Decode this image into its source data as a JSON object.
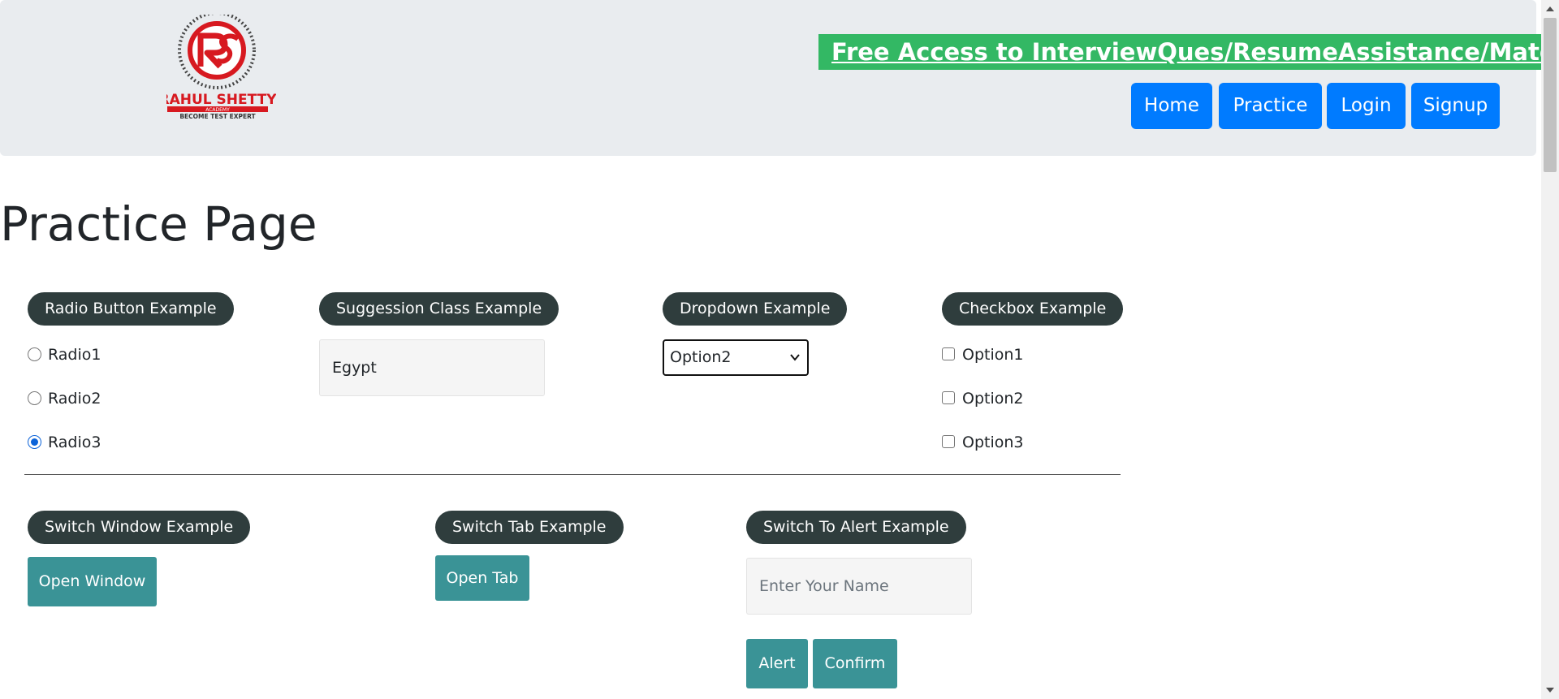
{
  "header": {
    "logo": {
      "name": "RAHUL SHETTY",
      "sub": "ACADEMY",
      "tagline": "BECOME TEST EXPERT"
    },
    "promo_link": "Free Access to InterviewQues/ResumeAssistance/Material",
    "nav": [
      "Home",
      "Practice",
      "Login",
      "Signup"
    ]
  },
  "page_title": "Practice Page",
  "radio_section": {
    "legend": "Radio Button Example",
    "options": [
      "Radio1",
      "Radio2",
      "Radio3"
    ],
    "selected": "Radio3"
  },
  "suggestion_section": {
    "legend": "Suggession Class Example",
    "value": "Egypt"
  },
  "dropdown_section": {
    "legend": "Dropdown Example",
    "selected": "Option2"
  },
  "checkbox_section": {
    "legend": "Checkbox Example",
    "options": [
      "Option1",
      "Option2",
      "Option3"
    ]
  },
  "switch_window": {
    "legend": "Switch Window Example",
    "button": "Open Window"
  },
  "switch_tab": {
    "legend": "Switch Tab Example",
    "button": "Open Tab"
  },
  "switch_alert": {
    "legend": "Switch To Alert Example",
    "placeholder": "Enter Your Name",
    "alert_button": "Alert",
    "confirm_button": "Confirm"
  },
  "colors": {
    "header_bg": "#e9ecef",
    "promo_bg": "#33b864",
    "nav_button": "#007bff",
    "legend_bg": "#2f3d3d",
    "teal_button": "#3a9396",
    "radio_checked": "#0b63d9"
  },
  "icons": [
    "rs-logo-icon",
    "chevron-down-icon",
    "scroll-up-icon",
    "scroll-down-icon"
  ]
}
